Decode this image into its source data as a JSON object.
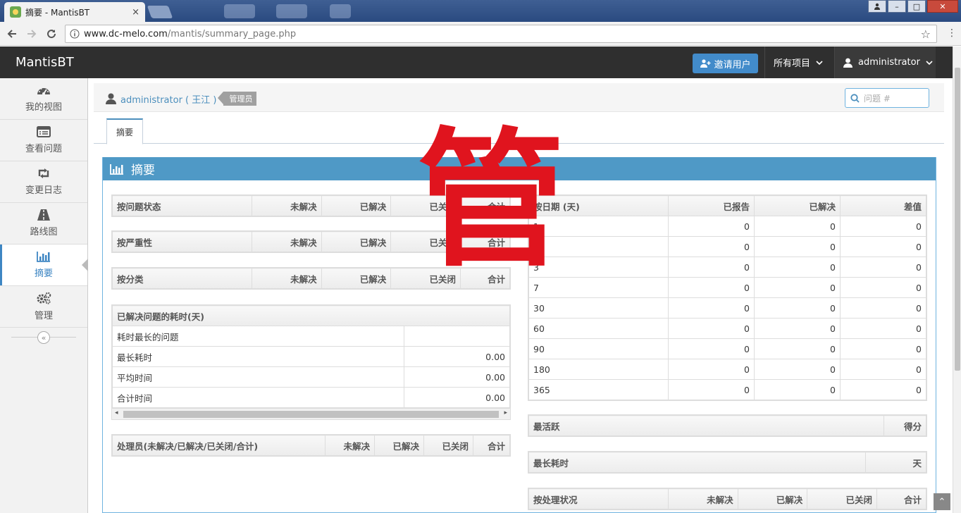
{
  "browser": {
    "tab_title": "摘要 - MantisBT",
    "tab_close": "×",
    "url_host": "www.dc-melo.com",
    "url_path": "/mantis/summary_page.php",
    "window_controls": {
      "minimize": "–",
      "maximize": "□",
      "close": "✕"
    }
  },
  "navbar": {
    "brand": "MantisBT",
    "invite_label": "邀请用户",
    "projects_label": "所有项目",
    "user_label": "administrator"
  },
  "sidebar": {
    "items": [
      {
        "label": "我的视图",
        "icon": "dashboard-icon"
      },
      {
        "label": "查看问题",
        "icon": "list-icon"
      },
      {
        "label": "变更日志",
        "icon": "retweet-icon"
      },
      {
        "label": "路线图",
        "icon": "road-icon"
      },
      {
        "label": "摘要",
        "icon": "bar-chart-icon"
      },
      {
        "label": "管理",
        "icon": "gears-icon"
      }
    ],
    "collapse_glyph": "«"
  },
  "breadcrumb": {
    "user": "administrator ( 王江 )",
    "role_badge": "管理员"
  },
  "search": {
    "placeholder": "问题 #"
  },
  "tabs": {
    "summary": "摘要"
  },
  "widget": {
    "title": "摘要"
  },
  "watermark": "管",
  "left_tables": {
    "by_status": {
      "headers": [
        "按问题状态",
        "未解决",
        "已解决",
        "已关闭",
        "合计"
      ]
    },
    "by_severity": {
      "headers": [
        "按严重性",
        "未解决",
        "已解决",
        "已关闭",
        "合计"
      ]
    },
    "by_category": {
      "headers": [
        "按分类",
        "未解决",
        "已解决",
        "已关闭",
        "合计"
      ]
    },
    "resolution_time": {
      "header": "已解决问题的耗时(天)",
      "rows": [
        {
          "label": "耗时最长的问题",
          "value": ""
        },
        {
          "label": "最长耗时",
          "value": "0.00"
        },
        {
          "label": "平均时间",
          "value": "0.00"
        },
        {
          "label": "合计时间",
          "value": "0.00"
        }
      ],
      "scroll_left": "◂",
      "scroll_right": "▸"
    },
    "by_handler": {
      "headers": [
        "处理员(未解决/已解决/已关闭/合计)",
        "未解决",
        "已解决",
        "已关闭",
        "合计"
      ]
    }
  },
  "right_tables": {
    "by_date": {
      "headers": [
        "按日期 (天)",
        "已报告",
        "已解决",
        "差值"
      ],
      "rows": [
        [
          "1",
          "0",
          "0",
          "0"
        ],
        [
          "2",
          "0",
          "0",
          "0"
        ],
        [
          "3",
          "0",
          "0",
          "0"
        ],
        [
          "7",
          "0",
          "0",
          "0"
        ],
        [
          "30",
          "0",
          "0",
          "0"
        ],
        [
          "60",
          "0",
          "0",
          "0"
        ],
        [
          "90",
          "0",
          "0",
          "0"
        ],
        [
          "180",
          "0",
          "0",
          "0"
        ],
        [
          "365",
          "0",
          "0",
          "0"
        ]
      ]
    },
    "most_active": {
      "headers": [
        "最活跃",
        "得分"
      ]
    },
    "longest_open": {
      "headers": [
        "最长耗时",
        "天"
      ]
    },
    "by_resolution": {
      "headers": [
        "按处理状况",
        "未解决",
        "已解决",
        "已关闭",
        "合计"
      ]
    }
  },
  "scroll_top_glyph": "⌃"
}
